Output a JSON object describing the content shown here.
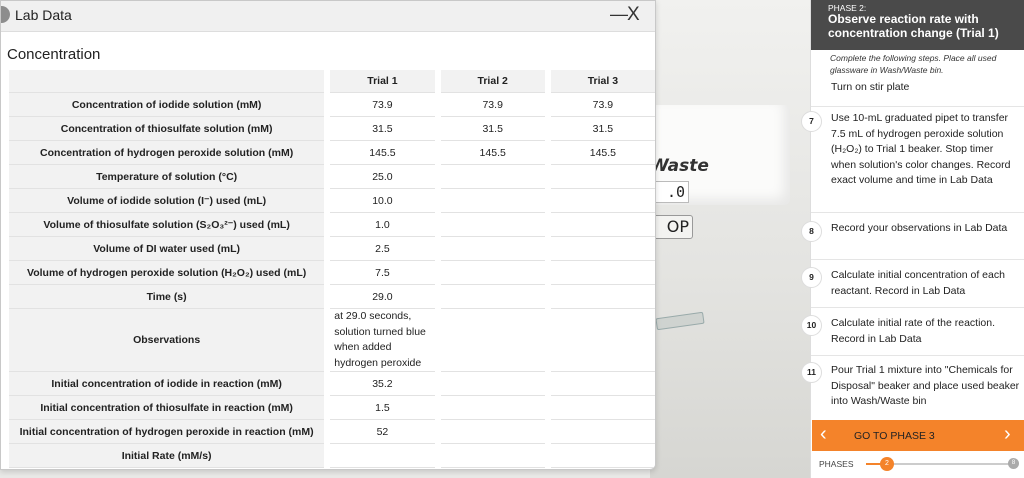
{
  "scene": {
    "bin_label": "Waste",
    "readout": ".0",
    "stop_label": "OP"
  },
  "window": {
    "title": "Lab Data",
    "minimize": "—",
    "close": "X",
    "section_title": "Concentration"
  },
  "table": {
    "columns": [
      "Trial 1",
      "Trial 2",
      "Trial 3"
    ],
    "rows": [
      {
        "label": "Concentration of iodide solution (mM)",
        "values": [
          "73.9",
          "73.9",
          "73.9"
        ]
      },
      {
        "label": "Concentration of thiosulfate solution (mM)",
        "values": [
          "31.5",
          "31.5",
          "31.5"
        ]
      },
      {
        "label": "Concentration of hydrogen peroxide solution (mM)",
        "values": [
          "145.5",
          "145.5",
          "145.5"
        ]
      },
      {
        "label": "Temperature of solution (°C)",
        "values": [
          "25.0",
          "",
          ""
        ]
      },
      {
        "label": "Volume of iodide solution (I⁻) used (mL)",
        "values": [
          "10.0",
          "",
          ""
        ]
      },
      {
        "label": "Volume of thiosulfate solution (S₂O₃²⁻) used (mL)",
        "values": [
          "1.0",
          "",
          ""
        ]
      },
      {
        "label": "Volume of DI water used (mL)",
        "values": [
          "2.5",
          "",
          ""
        ]
      },
      {
        "label": "Volume of hydrogen peroxide solution (H₂O₂) used (mL)",
        "values": [
          "7.5",
          "",
          ""
        ]
      },
      {
        "label": "Time (s)",
        "values": [
          "29.0",
          "",
          ""
        ]
      },
      {
        "label": "Observations",
        "values": [
          "at 29.0 seconds, solution turned blue when added hydrogen peroxide",
          "",
          ""
        ]
      },
      {
        "label": "Initial concentration of iodide in reaction (mM)",
        "values": [
          "35.2",
          "",
          ""
        ]
      },
      {
        "label": "Initial concentration of thiosulfate in reaction (mM)",
        "values": [
          "1.5",
          "",
          ""
        ]
      },
      {
        "label": "Initial concentration of hydrogen peroxide in reaction (mM)",
        "values": [
          "52",
          "",
          ""
        ]
      },
      {
        "label": "Initial Rate (mM/s)",
        "values": [
          "",
          "",
          ""
        ]
      }
    ]
  },
  "panel": {
    "phase_number": "PHASE 2:",
    "phase_title": "Observe reaction rate with concentration change (Trial 1)",
    "instructions": "Complete the following steps. Place all used glassware in Wash/Waste bin.",
    "step6_text": "Turn on stir plate",
    "steps": [
      {
        "num": "7",
        "text": "Use 10-mL graduated pipet to transfer 7.5 mL of hydrogen peroxide solution (H₂O₂) to Trial 1 beaker. Stop timer when solution's color changes. Record exact volume and time in Lab Data"
      },
      {
        "num": "8",
        "text": "Record your observations in Lab Data"
      },
      {
        "num": "9",
        "text": "Calculate initial concentration of each reactant. Record in Lab Data"
      },
      {
        "num": "10",
        "text": "Calculate initial rate of the reaction. Record in Lab Data"
      },
      {
        "num": "11",
        "text": "Pour Trial 1 mixture into \"Chemicals for Disposal\" beaker and place used beaker into Wash/Waste bin"
      }
    ],
    "go_label": "GO TO PHASE 3",
    "go_left": "‹",
    "go_right": "›",
    "phases_label": "PHASES",
    "current_phase": "2",
    "total_phases": "8",
    "progress_fraction": 0.14
  }
}
